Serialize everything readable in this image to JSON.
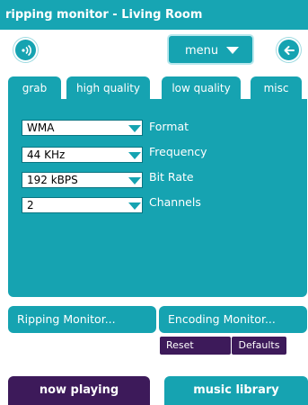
{
  "window": {
    "title": "ripping monitor - Living Room"
  },
  "toolbar": {
    "menu_label": "menu"
  },
  "tabs": [
    {
      "label": "grab",
      "selected": false
    },
    {
      "label": "high quality",
      "selected": true
    },
    {
      "label": "low quality",
      "selected": false
    },
    {
      "label": "misc",
      "selected": false
    }
  ],
  "settings": [
    {
      "value": "WMA",
      "label": "Format"
    },
    {
      "value": "44 KHz",
      "label": "Frequency"
    },
    {
      "value": "192 kBPS",
      "label": "Bit Rate"
    },
    {
      "value": "2",
      "label": "Channels"
    }
  ],
  "monitors": {
    "ripping": "Ripping Monitor...",
    "encoding": "Encoding Monitor..."
  },
  "actions": {
    "reset": "Reset",
    "defaults": "Defaults"
  },
  "nav": {
    "now_playing": "now playing",
    "music_library": "music library"
  },
  "colors": {
    "teal": "#16a3b1",
    "purple": "#3d1a5a",
    "white": "#ffffff"
  },
  "icons": {
    "speaker": "speaker-icon",
    "back": "back-arrow-icon",
    "menu_caret": "chevron-down-icon"
  }
}
